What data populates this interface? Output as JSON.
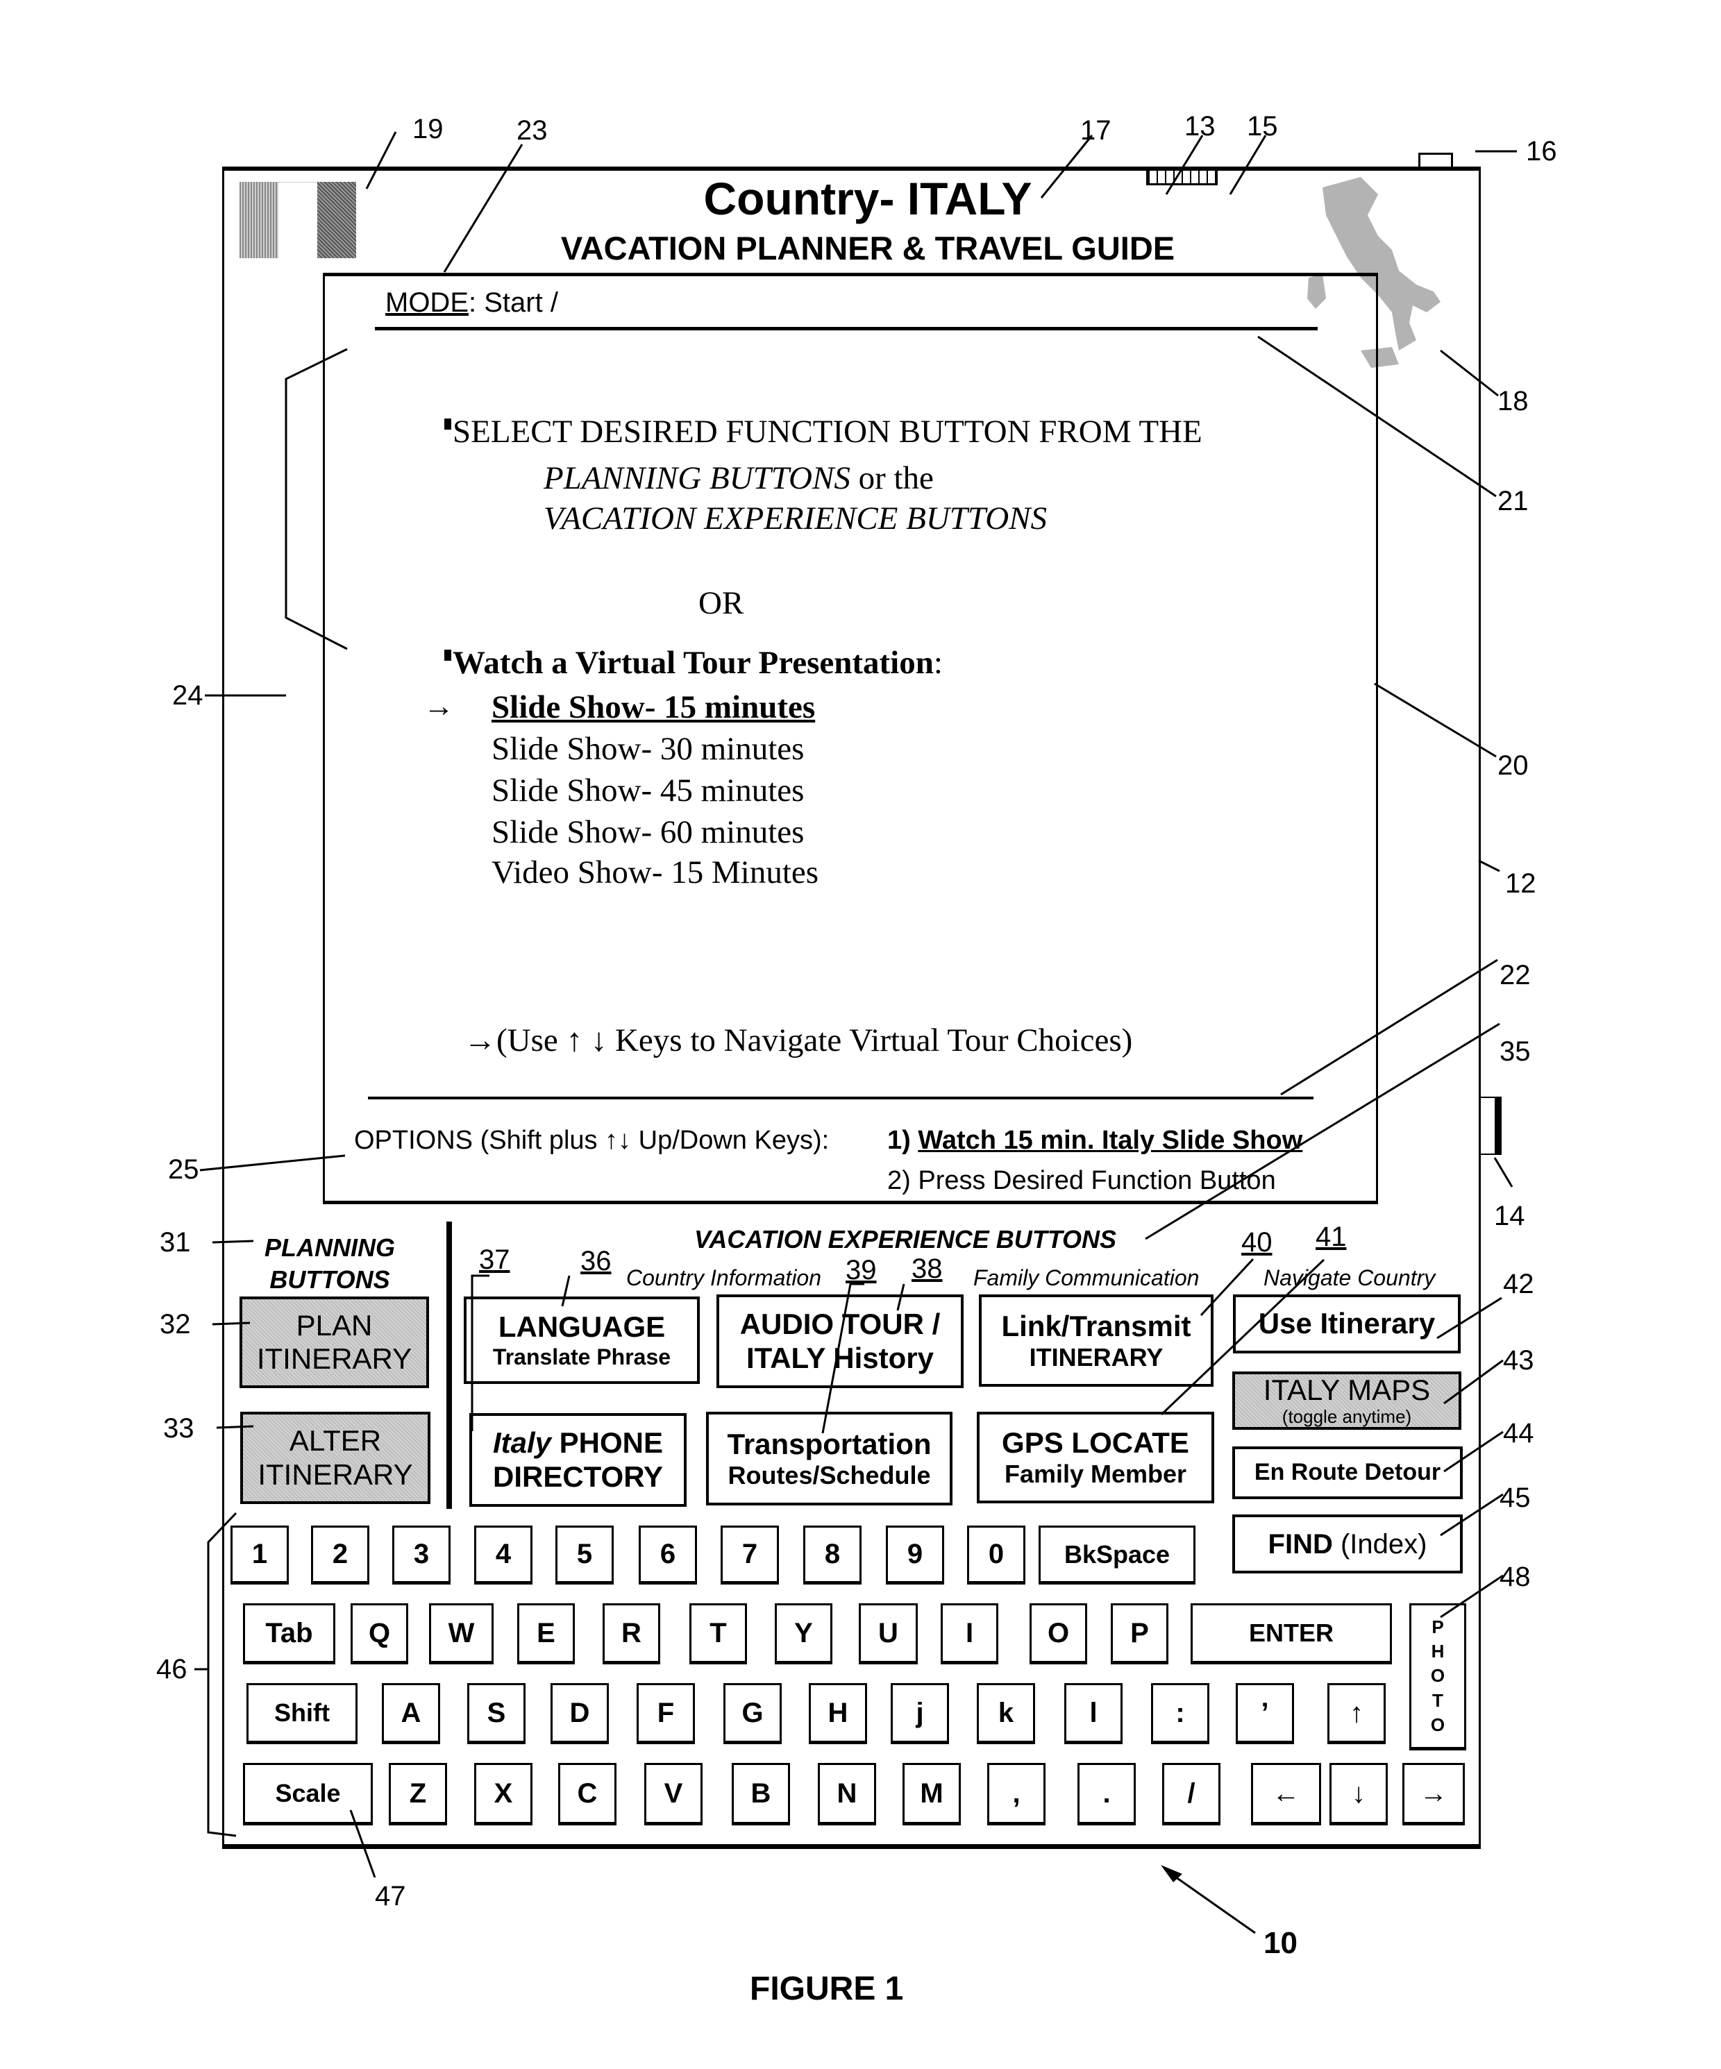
{
  "header": {
    "title": "Country- ITALY",
    "subtitle": "VACATION PLANNER & TRAVEL GUIDE"
  },
  "screen": {
    "mode_label": "MODE",
    "mode_value": ": Start /",
    "instruction": {
      "line1": "SELECT DESIRED FUNCTION BUTTON FROM THE",
      "line2_italic": "PLANNING BUTTONS",
      "line2_rest": " or the",
      "line3_italic": "VACATION EXPERIENCE BUTTONS"
    },
    "or": "OR",
    "watch_heading": "Watch a Virtual Tour Presentation",
    "watch_colon": ":",
    "selection_arrow": "→",
    "tours": [
      {
        "label": "Slide Show- 15 minutes",
        "selected": true
      },
      {
        "label": "Slide Show- 30 minutes",
        "selected": false
      },
      {
        "label": "Slide Show- 45 minutes",
        "selected": false
      },
      {
        "label": "Slide Show- 60 minutes",
        "selected": false
      },
      {
        "label": "Video Show- 15 Minutes",
        "selected": false
      }
    ],
    "nav_hint": "→(Use ↑ ↓ Keys to Navigate Virtual Tour Choices)",
    "options_label": "OPTIONS (Shift plus ↑↓ Up/Down Keys):",
    "option1_num": "1) ",
    "option1_text": "Watch 15 min. Italy Slide Show",
    "option2": "2) Press Desired Function Button"
  },
  "planning": {
    "title_line1": "PLANNING",
    "title_line2": "BUTTONS",
    "buttons": [
      {
        "line1": "PLAN",
        "line2": "ITINERARY"
      },
      {
        "line1": "ALTER",
        "line2": "ITINERARY"
      }
    ]
  },
  "vacation": {
    "title": "VACATION EXPERIENCE BUTTONS",
    "categories": [
      "Country Information",
      "Family Communication",
      "Navigate Country"
    ],
    "buttons": {
      "language": {
        "line1": "LANGUAGE",
        "line2": "Translate Phrase"
      },
      "audio_tour": {
        "line1": "AUDIO TOUR /",
        "line2": "ITALY History"
      },
      "link_transmit": {
        "line1": "Link/Transmit",
        "line2": "ITINERARY"
      },
      "use_itinerary": {
        "line1": "Use Itinerary"
      },
      "phone_directory": {
        "line1_italic": "Italy",
        "line1_rest": " PHONE",
        "line2": "DIRECTORY"
      },
      "transportation": {
        "line1": "Transportation",
        "line2": "Routes/Schedule"
      },
      "gps_locate": {
        "line1": "GPS LOCATE",
        "line2": "Family Member"
      },
      "italy_maps": {
        "line1": "ITALY MAPS",
        "line2": "(toggle anytime)"
      },
      "en_route": {
        "line1": "En Route Detour"
      },
      "find": {
        "bold": "FIND",
        "rest": " (Index)"
      }
    }
  },
  "keyboard": {
    "row1": [
      "1",
      "2",
      "3",
      "4",
      "5",
      "6",
      "7",
      "8",
      "9",
      "0",
      "BkSpace"
    ],
    "row2": [
      "Tab",
      "Q",
      "W",
      "E",
      "R",
      "T",
      "Y",
      "U",
      "I",
      "O",
      "P",
      "ENTER"
    ],
    "row3": [
      "Shift",
      "A",
      "S",
      "D",
      "F",
      "G",
      "H",
      "j",
      "k",
      "l",
      ":",
      "’",
      "↑"
    ],
    "row4": [
      "Scale",
      "Z",
      "X",
      "C",
      "V",
      "B",
      "N",
      "M",
      ",",
      ".",
      "/",
      "←",
      "↓",
      "→"
    ],
    "photo": [
      "P",
      "H",
      "O",
      "T",
      "O"
    ]
  },
  "reference_numerals": {
    "r10": "10",
    "r12": "12",
    "r13": "13",
    "r14": "14",
    "r15": "15",
    "r16": "16",
    "r17": "17",
    "r18": "18",
    "r19": "19",
    "r20": "20",
    "r21": "21",
    "r22": "22",
    "r23": "23",
    "r24": "24",
    "r25": "25",
    "r31": "31",
    "r32": "32",
    "r33": "33",
    "r35": "35",
    "r36": "36",
    "r37": "37",
    "r38": "38",
    "r39": "39",
    "r40": "40",
    "r41": "41",
    "r42": "42",
    "r43": "43",
    "r44": "44",
    "r45": "45",
    "r46": "46",
    "r47": "47",
    "r48": "48"
  },
  "caption": "FIGURE 1"
}
